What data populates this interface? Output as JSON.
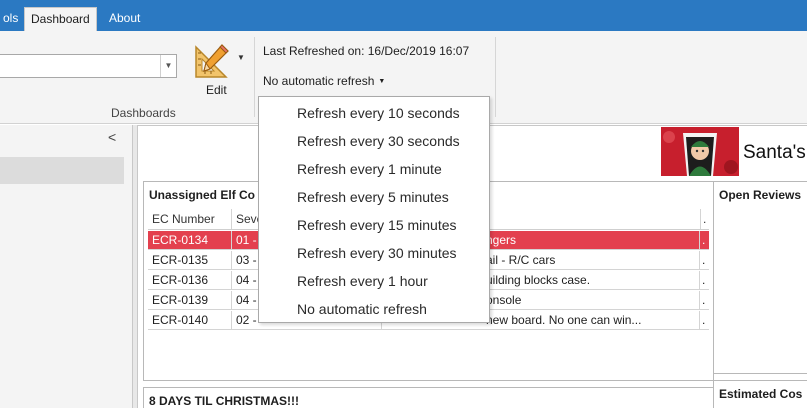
{
  "menubar": {
    "tabs": [
      {
        "label": "ols"
      },
      {
        "label": "Dashboard"
      },
      {
        "label": "About"
      }
    ]
  },
  "ribbon": {
    "edit_label": "Edit",
    "last_refreshed": "Last Refreshed on: 16/Dec/2019 16:07",
    "auto_refresh": "No automatic refresh",
    "group_label": "Dashboards"
  },
  "refresh_menu": {
    "items": [
      "Refresh every 10 seconds",
      "Refresh every 30 seconds",
      "Refresh every 1 minute",
      "Refresh every 5 minutes",
      "Refresh every 15 minutes",
      "Refresh every 30 minutes",
      "Refresh every 1 hour",
      "No automatic refresh"
    ]
  },
  "dashboard": {
    "title": "Santa's",
    "unassigned_panel": {
      "title": "Unassigned Elf Co",
      "columns": [
        "EC Number",
        "Seve",
        "."
      ],
      "rows": [
        {
          "ec": "ECR-0134",
          "sev": "01 -",
          "desc": "ngers",
          "selected": true
        },
        {
          "ec": "ECR-0135",
          "sev": "03 -",
          "desc": "ail - R/C cars",
          "selected": false
        },
        {
          "ec": "ECR-0136",
          "sev": "04 -",
          "desc": "uilding blocks case.",
          "selected": false
        },
        {
          "ec": "ECR-0139",
          "sev": "04 -",
          "desc": "onsole",
          "selected": false
        },
        {
          "ec": "ECR-0140",
          "sev": "02 -",
          "desc": " new board. No one can win...",
          "selected": false
        }
      ],
      "trail": "."
    },
    "open_reviews_title": "Open Reviews",
    "countdown_title": "8 DAYS TIL CHRISTMAS!!!",
    "estimated_title": "Estimated Cos"
  },
  "colors": {
    "menubar": "#2b79c2",
    "selected_row": "#e3404e"
  }
}
